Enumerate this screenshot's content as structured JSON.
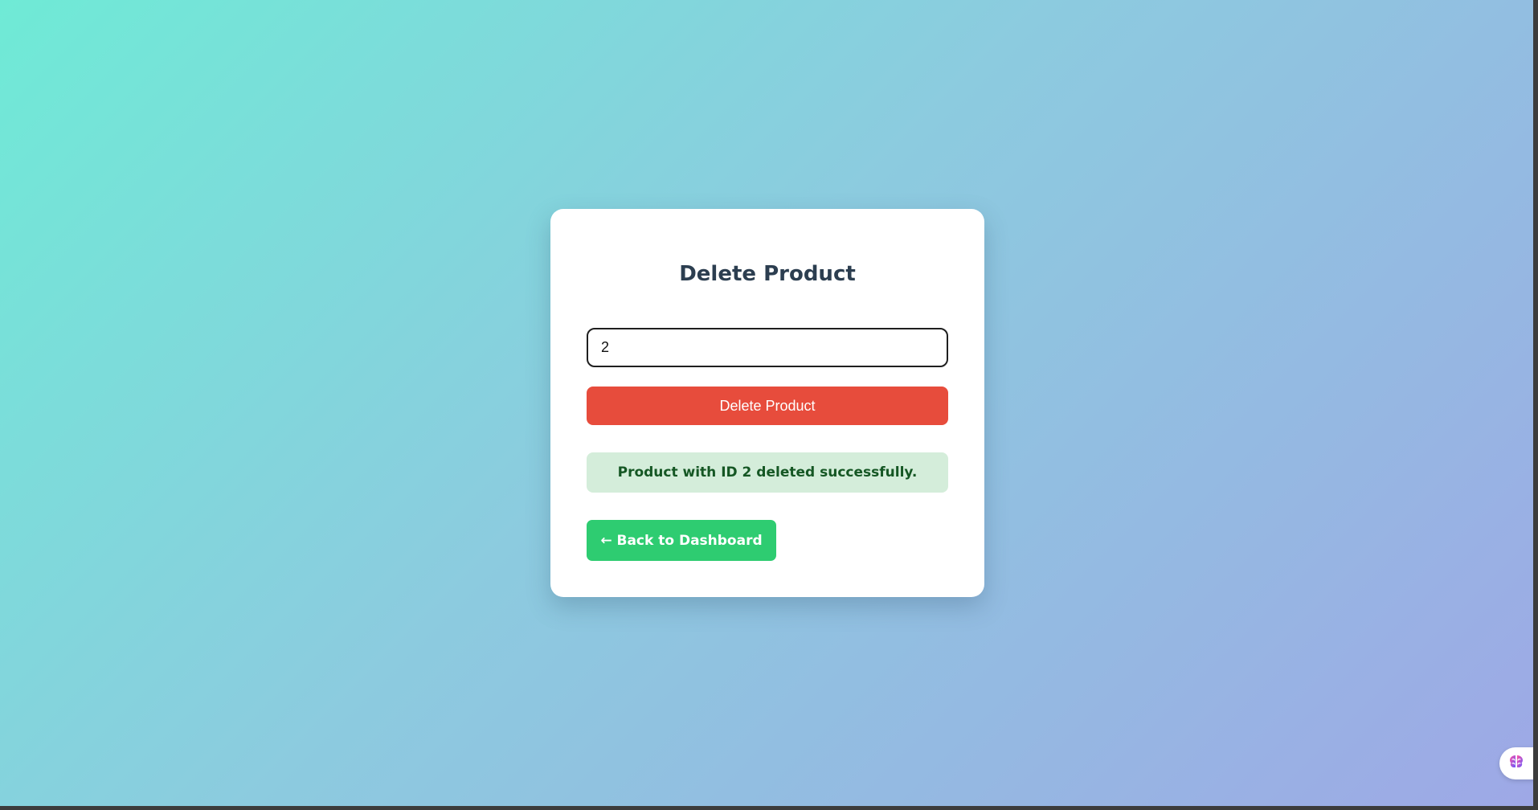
{
  "page": {
    "title": "Delete Product"
  },
  "form": {
    "product_id_value": "2",
    "delete_button_label": "Delete Product"
  },
  "status": {
    "message": "Product with ID 2 deleted successfully."
  },
  "navigation": {
    "back_label": "← Back to Dashboard"
  },
  "extension": {
    "icon": "brain-icon"
  },
  "colors": {
    "title": "#2c3e50",
    "delete_button": "#e74c3c",
    "success_bg": "#d4edda",
    "success_text": "#155724",
    "back_button": "#2ecc71"
  }
}
